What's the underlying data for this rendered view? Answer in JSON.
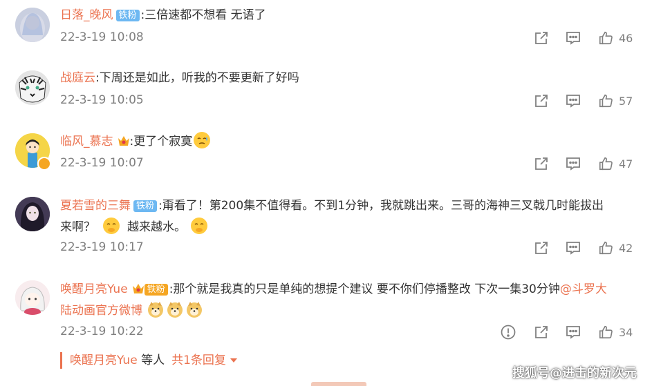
{
  "comments": [
    {
      "username": "日落_晚风",
      "badge": "铁粉",
      "text": ":三倍速都不想看 无语了",
      "text2": "",
      "time": "22-3-19 10:08",
      "likes": "46",
      "avatar": "girl-blue-hair"
    },
    {
      "username": "战庭云",
      "badge": "",
      "text": ":下周还是如此，听我的不要更新了好吗",
      "text2": "",
      "time": "22-3-19 10:05",
      "likes": "57",
      "avatar": "white-tiger"
    },
    {
      "username": "临风_慕志",
      "badge": "",
      "text": ":更了个寂寞",
      "text2": "",
      "time": "22-3-19 10:07",
      "likes": "47",
      "avatar": "cartoon-boy"
    },
    {
      "username": "夏若雪的三舞",
      "badge": "铁粉",
      "text": ":甭看了！第200集不值得看。不到1分钟，我就跳出来。三哥的海神三叉戟几时能拔出",
      "text2a": "来啊？",
      "text2b": "越来越水。",
      "time": "22-3-19 10:17",
      "likes": "42",
      "avatar": "anime-girl-dark"
    },
    {
      "username": "唤醒月亮Yue",
      "badge": "铁粉",
      "text": ":那个就是我真的只是单纯的想提个建议 要不你们停播整改 下次一集30分钟",
      "mention": "@斗罗大",
      "text2": "陆动画官方微博",
      "time": "22-3-19 10:22",
      "likes": "34",
      "avatar": "cute-girl-pink"
    }
  ],
  "reply_bar": {
    "who": "唤醒月亮Yue",
    "rest": " 等人",
    "count": "共1条回复"
  },
  "watermark": "搜狐号@进击的新次元",
  "icons": {
    "share": "share-icon",
    "comment": "comment-icon",
    "like": "thumbs-up-icon",
    "report": "report-icon"
  },
  "colors": {
    "username": "#eb7350",
    "badge": "#6db8f2",
    "meta": "#808080"
  }
}
